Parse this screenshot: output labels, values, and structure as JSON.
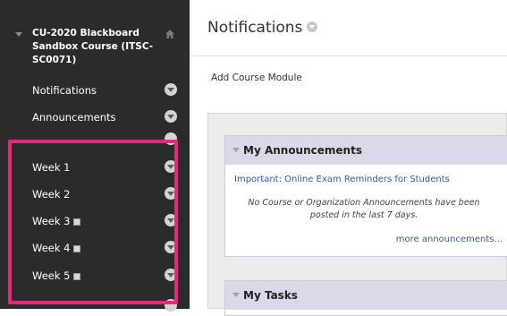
{
  "sidebar": {
    "course_title": "CU-2020 Blackboard Sandbox Course (ITSC-SC0071)",
    "items": [
      {
        "label": "Notifications",
        "has_doc_icon": false
      },
      {
        "label": "Announcements",
        "has_doc_icon": false
      },
      {
        "label": "Week 1",
        "has_doc_icon": false
      },
      {
        "label": "Week 2",
        "has_doc_icon": false
      },
      {
        "label": "Week 3",
        "has_doc_icon": true
      },
      {
        "label": "Week 4",
        "has_doc_icon": true
      },
      {
        "label": "Week 5",
        "has_doc_icon": true
      }
    ],
    "highlight_color": "#e4287c"
  },
  "main": {
    "page_title": "Notifications",
    "add_module_label": "Add Course Module",
    "modules": {
      "announcements": {
        "title": "My Announcements",
        "link": "Important: Online Exam Reminders for Students",
        "note": "No Course or Organization Announcements have been posted in the last 7 days.",
        "more_link": "more announcements..."
      },
      "tasks": {
        "title": "My Tasks"
      }
    }
  },
  "icons": {
    "home": "home-icon",
    "chevron": "chevron-down-icon",
    "caret": "caret-down-icon",
    "doc": "document-icon"
  }
}
